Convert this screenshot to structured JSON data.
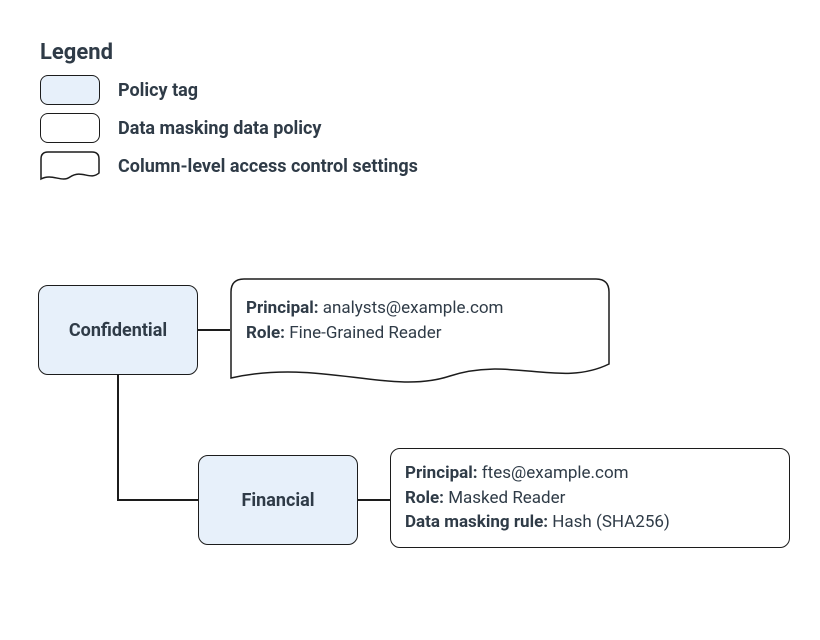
{
  "legend": {
    "title": "Legend",
    "items": [
      {
        "label": "Policy tag"
      },
      {
        "label": "Data masking data policy"
      },
      {
        "label": "Column-level access control settings"
      }
    ]
  },
  "nodes": {
    "confidential": {
      "label": "Confidential"
    },
    "financial": {
      "label": "Financial"
    }
  },
  "clacs_box": {
    "principal_label": "Principal:",
    "principal_value": "analysts@example.com",
    "role_label": "Role:",
    "role_value": "Fine-Grained Reader"
  },
  "masking_box": {
    "principal_label": "Principal:",
    "principal_value": "ftes@example.com",
    "role_label": "Role:",
    "role_value": "Masked Reader",
    "rule_label": "Data masking rule:",
    "rule_value": "Hash (SHA256)"
  }
}
